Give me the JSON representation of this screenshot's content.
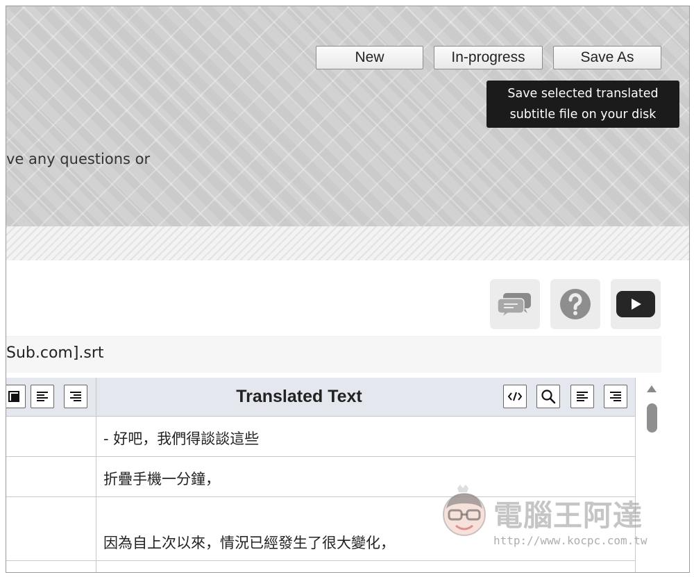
{
  "toolbar": {
    "new_label": "New",
    "inprogress_label": "In-progress",
    "saveas_label": "Save As"
  },
  "tooltip": {
    "line1": "Save selected translated",
    "line2": "subtitle file on your disk"
  },
  "intro": {
    "text": "ve any questions or"
  },
  "icons": [
    "chat-bubbles-icon",
    "help-icon",
    "youtube-play-icon"
  ],
  "file": {
    "name": "Sub.com].srt"
  },
  "table": {
    "header_title": "Translated Text",
    "rows": [
      {
        "translated": "- 好吧，我們得談談這些"
      },
      {
        "translated": "折疊手機一分鐘，"
      },
      {
        "translated": "因為自上次以來，情況已經發生了很大變化，"
      }
    ]
  },
  "watermark": {
    "title": "電腦王阿達",
    "url": "http://www.kocpc.com.tw"
  },
  "colors": {
    "tooltip_bg": "#1b1b1b",
    "header_bg": "#d2d2d2",
    "table_head_bg": "#e4e8ee"
  }
}
